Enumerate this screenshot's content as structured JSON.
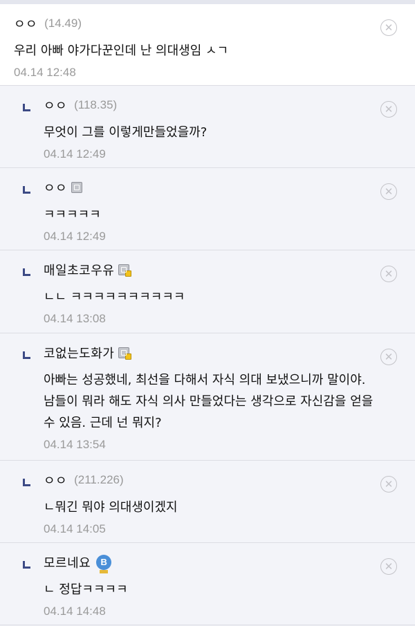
{
  "comments": [
    {
      "nick": "ㅇㅇ",
      "ip": "(14.49)",
      "text": "우리 아빠 야가다꾼인데 난 의대생임 ㅅㄱ",
      "date": "04.14 12:48"
    },
    {
      "nick": "ㅇㅇ",
      "ip": "(118.35)",
      "text": "무엇이 그를 이렇게만들었을까?",
      "date": "04.14 12:49"
    },
    {
      "nick": "ㅇㅇ",
      "text": "ㅋㅋㅋㅋㅋ",
      "date": "04.14 12:49",
      "icon": "fixed-nick-icon"
    },
    {
      "nick": "매일초코우유",
      "text": "ㄴㄴ ㅋㅋㅋㅋㅋㅋㅋㅋㅋㅋ",
      "date": "04.14 13:08",
      "icon": "half-fixed-nick-icon"
    },
    {
      "nick": "코없는도화가",
      "text": "아빠는 성공했네, 최선을 다해서 자식 의대 보냈으니까 말이야. 남들이 뭐라 해도 자식 의사 만들었다는 생각으로 자신감을 얻을 수 있음. 근데 넌 뭐지?",
      "date": "04.14 13:54",
      "icon": "half-fixed-nick-icon"
    },
    {
      "nick": "ㅇㅇ",
      "ip": "(211.226)",
      "text": "ㄴ뭐긴 뭐야 의대생이겠지",
      "date": "04.14 14:05"
    },
    {
      "nick": "모르네요",
      "text": "ㄴ 정답ㅋㅋㅋㅋ",
      "date": "04.14 14:48",
      "icon": "b-badge-icon",
      "badge": "B"
    }
  ],
  "delete_symbol": "✕"
}
